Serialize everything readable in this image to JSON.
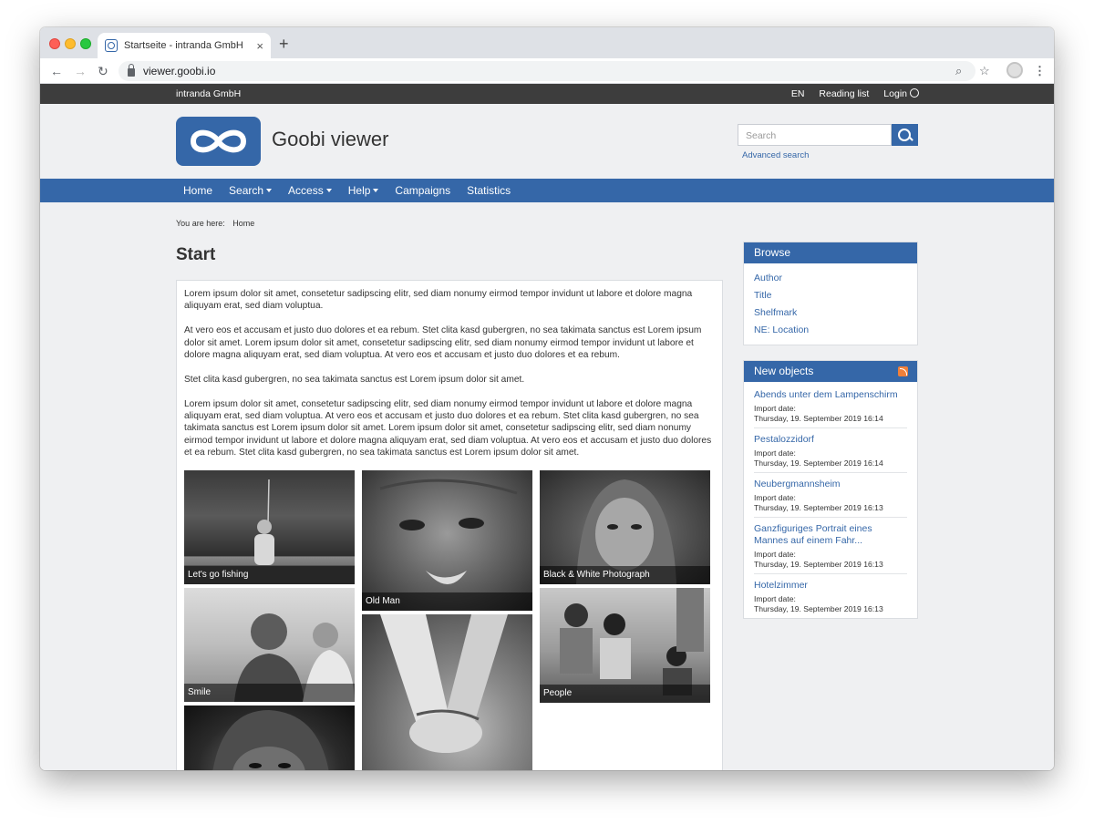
{
  "browser": {
    "tab_title": "Startseite - intranda GmbH",
    "tab_close": "×",
    "new_tab": "+",
    "url": "viewer.goobi.io"
  },
  "topbar": {
    "org": "intranda GmbH",
    "lang": "EN",
    "reading_list": "Reading list",
    "login": "Login"
  },
  "header": {
    "brand": "Goobi viewer",
    "search_placeholder": "Search",
    "advanced_search": "Advanced search",
    "brand_color": "#3567a8"
  },
  "nav": {
    "items": [
      {
        "label": "Home",
        "dropdown": false
      },
      {
        "label": "Search",
        "dropdown": true
      },
      {
        "label": "Access",
        "dropdown": true
      },
      {
        "label": "Help",
        "dropdown": true
      },
      {
        "label": "Campaigns",
        "dropdown": false
      },
      {
        "label": "Statistics",
        "dropdown": false
      }
    ]
  },
  "breadcrumb": {
    "prefix": "You are here:",
    "current": "Home"
  },
  "main": {
    "title": "Start",
    "paragraphs": [
      "Lorem ipsum dolor sit amet, consetetur sadipscing elitr, sed diam nonumy eirmod tempor invidunt ut labore et dolore magna aliquyam erat, sed diam voluptua.",
      "At vero eos et accusam et justo duo dolores et ea rebum. Stet clita kasd gubergren, no sea takimata sanctus est Lorem ipsum dolor sit amet. Lorem ipsum dolor sit amet, consetetur sadipscing elitr, sed diam nonumy eirmod tempor invidunt ut labore et dolore magna aliquyam erat, sed diam voluptua. At vero eos et accusam et justo duo dolores et ea rebum.",
      "Stet clita kasd gubergren, no sea takimata sanctus est Lorem ipsum dolor sit amet.",
      "Lorem ipsum dolor sit amet, consetetur sadipscing elitr, sed diam nonumy eirmod tempor invidunt ut labore et dolore magna aliquyam erat, sed diam voluptua. At vero eos et accusam et justo duo dolores et ea rebum. Stet clita kasd gubergren, no sea takimata sanctus est Lorem ipsum dolor sit amet. Lorem ipsum dolor sit amet, consetetur sadipscing elitr, sed diam nonumy eirmod tempor invidunt ut labore et dolore magna aliquyam erat, sed diam voluptua. At vero eos et accusam et justo duo dolores et ea rebum. Stet clita kasd gubergren, no sea takimata sanctus est Lorem ipsum dolor sit amet."
    ],
    "gallery": [
      {
        "caption": "Let's go fishing"
      },
      {
        "caption": "Old Man"
      },
      {
        "caption": "Black & White Photograph"
      },
      {
        "caption": "Smile"
      },
      {
        "caption": "People"
      }
    ]
  },
  "sidebar": {
    "browse": {
      "title": "Browse",
      "links": [
        "Author",
        "Title",
        "Shelfmark",
        "NE: Location"
      ]
    },
    "new_objects": {
      "title": "New objects",
      "items": [
        {
          "title": "Abends unter dem Lampenschirm",
          "label": "Import date:",
          "date": "Thursday, 19. September 2019 16:14"
        },
        {
          "title": "Pestalozzidorf",
          "label": "Import date:",
          "date": "Thursday, 19. September 2019 16:14"
        },
        {
          "title": "Neubergmannsheim",
          "label": "Import date:",
          "date": "Thursday, 19. September 2019 16:13"
        },
        {
          "title": "Ganzfiguriges Portrait eines Mannes auf einem Fahr...",
          "label": "Import date:",
          "date": "Thursday, 19. September 2019 16:13"
        },
        {
          "title": "Hotelzimmer",
          "label": "Import date:",
          "date": "Thursday, 19. September 2019 16:13"
        }
      ]
    }
  }
}
